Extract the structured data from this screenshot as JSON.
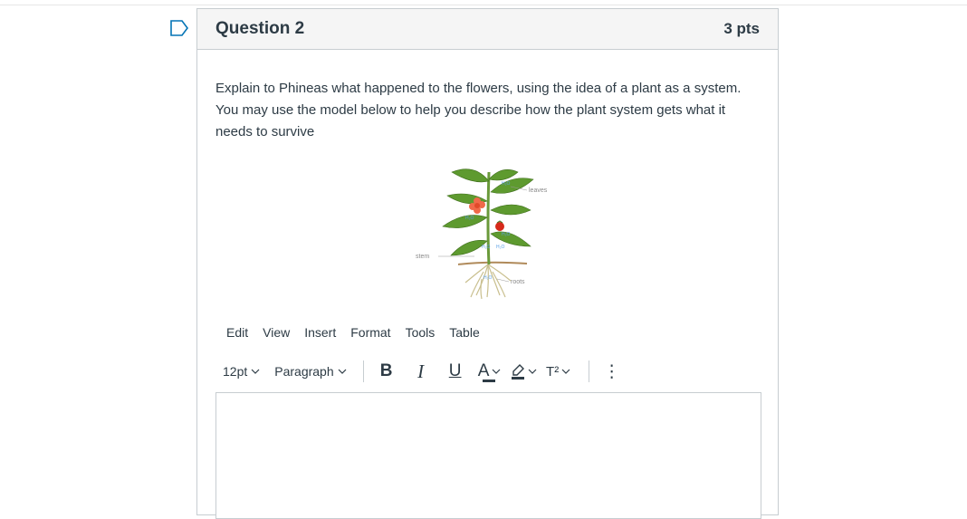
{
  "question": {
    "title": "Question 2",
    "points": "3 pts",
    "text": "Explain to Phineas what happened to the flowers, using the idea of a plant as a system.  You may use the model below to help you describe how the plant system gets what it needs to survive"
  },
  "figure": {
    "labels": {
      "leaves": "leaves",
      "stem": "stem",
      "roots": "roots"
    },
    "annotation": "H₂O"
  },
  "editor": {
    "menubar": [
      "Edit",
      "View",
      "Insert",
      "Format",
      "Tools",
      "Table"
    ],
    "font_size": "12pt",
    "block_format": "Paragraph",
    "buttons": {
      "bold": "B",
      "italic": "I",
      "underline": "U",
      "text_color": "A",
      "superscript": "T²",
      "more": "⋮"
    }
  },
  "colors": {
    "flag": "#0374b5",
    "border": "#c7cdd1",
    "header_bg": "#f5f5f5",
    "text": "#2d3b45"
  }
}
